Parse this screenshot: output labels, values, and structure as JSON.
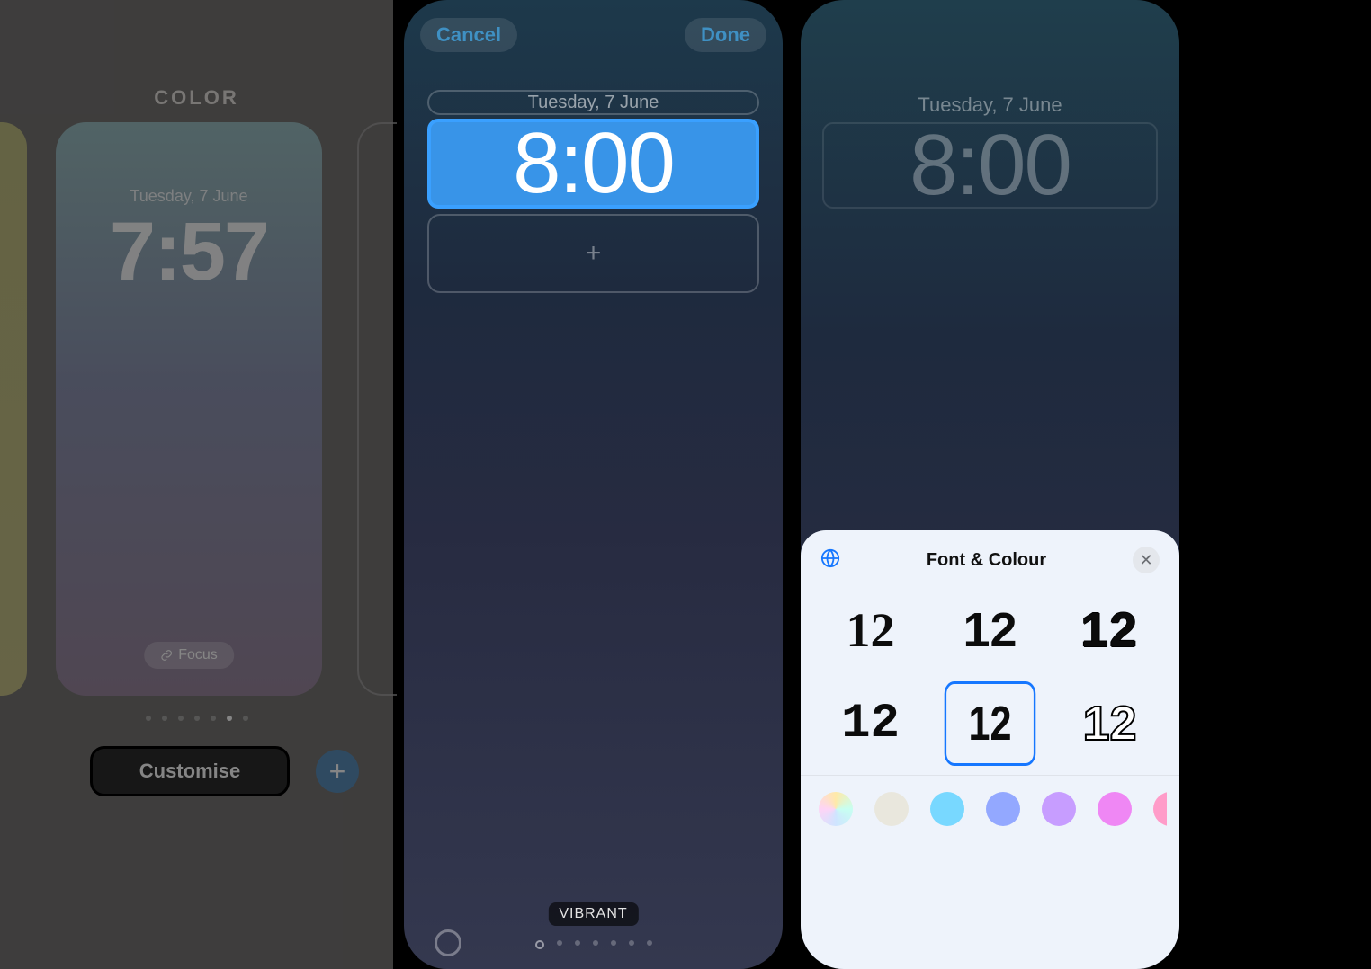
{
  "panel1": {
    "section_label": "COLOR",
    "card": {
      "date": "Tuesday, 7 June",
      "time": "7:57",
      "focus_label": "Focus"
    },
    "dots_total": 7,
    "dots_active_index": 5,
    "customise_label": "Customise",
    "add_label": "+"
  },
  "panel2": {
    "cancel_label": "Cancel",
    "done_label": "Done",
    "date": "Tuesday, 7 June",
    "time": "8:00",
    "add_widget_glyph": "+",
    "filter_label": "VIBRANT",
    "page_dots": 7
  },
  "panel3": {
    "date": "Tuesday, 7 June",
    "time": "8:00",
    "sheet": {
      "title": "Font & Colour",
      "close_glyph": "✕",
      "font_samples": [
        "12",
        "12",
        "12",
        "12",
        "12",
        "12"
      ],
      "selected_font_index": 4,
      "swatches": [
        "rainbow",
        "cream",
        "sky",
        "periwinkle",
        "lavender",
        "magenta",
        "pink",
        "coral"
      ]
    }
  }
}
